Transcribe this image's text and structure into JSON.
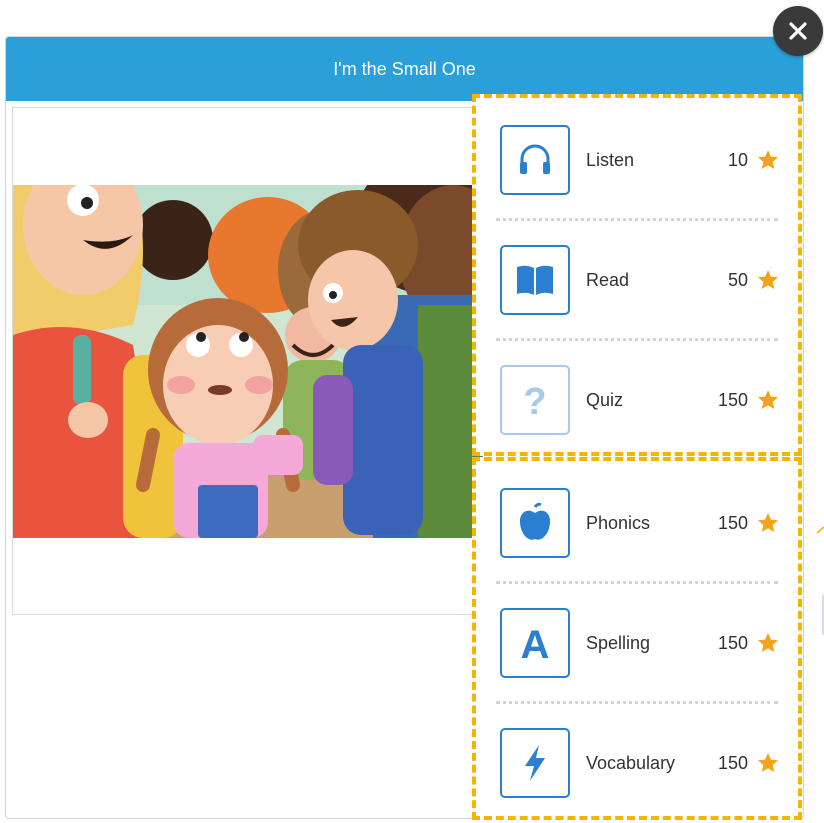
{
  "modal": {
    "title": "I'm the Small One"
  },
  "colors": {
    "header": "#2b9fd8",
    "icon_border": "#2b7fd0",
    "highlight_dash": "#f5b400",
    "star": "#f2a21b"
  },
  "groups": [
    {
      "items": [
        {
          "label": "Listen",
          "points": "10",
          "icon": "headphones-icon"
        },
        {
          "label": "Read",
          "points": "50",
          "icon": "open-book-icon"
        },
        {
          "label": "Quiz",
          "points": "150",
          "icon": "question-mark-icon"
        }
      ]
    },
    {
      "items": [
        {
          "label": "Phonics",
          "points": "150",
          "icon": "apple-icon"
        },
        {
          "label": "Spelling",
          "points": "150",
          "icon": "letter-a-icon"
        },
        {
          "label": "Vocabulary",
          "points": "150",
          "icon": "lightning-bolt-icon"
        }
      ]
    }
  ]
}
